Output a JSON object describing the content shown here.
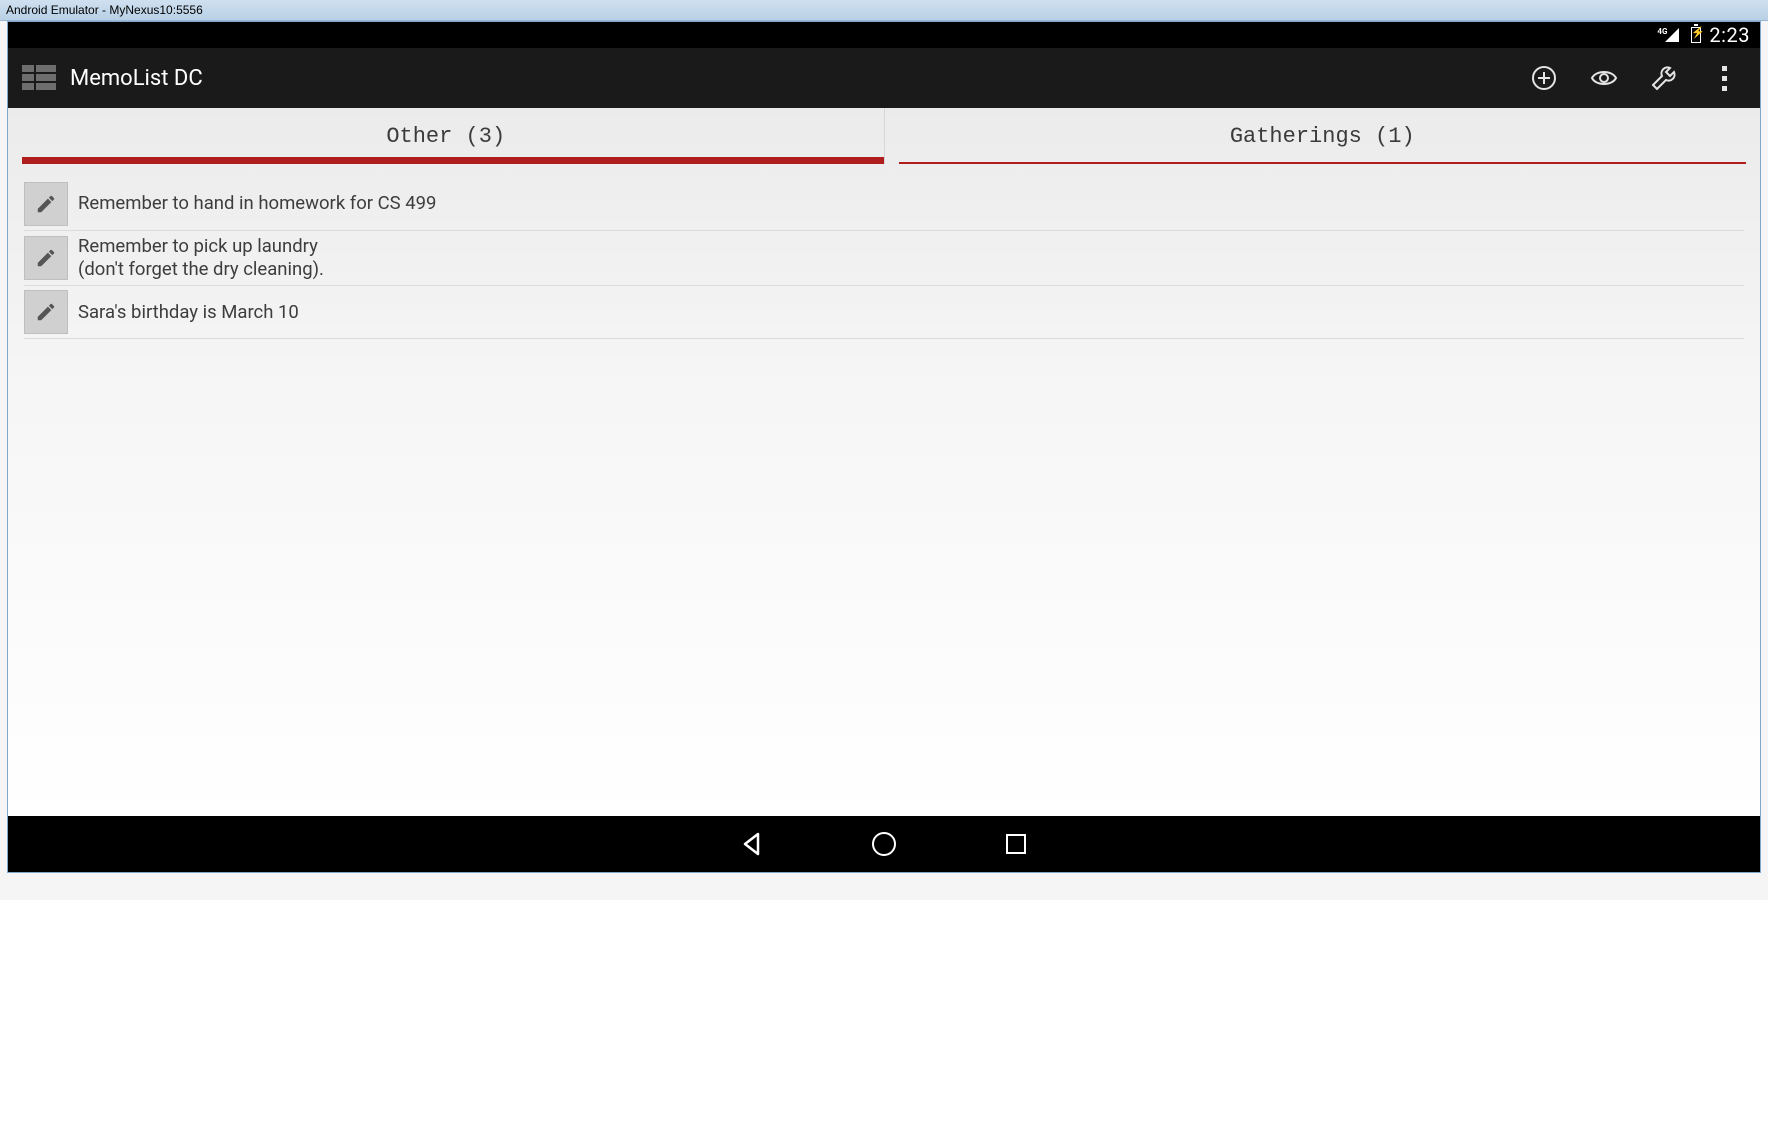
{
  "host": {
    "title": "Android Emulator - MyNexus10:5556"
  },
  "status_bar": {
    "network_label": "4G",
    "clock": "2:23"
  },
  "action_bar": {
    "title": "MemoList DC",
    "actions": {
      "add": "Add memo",
      "view": "View",
      "tools": "Tools",
      "overflow": "More options"
    }
  },
  "tabs": [
    {
      "label": "Other (3)",
      "active": true
    },
    {
      "label": "Gatherings (1)",
      "active": false
    }
  ],
  "memos": [
    {
      "text": "Remember to hand in homework for CS 499"
    },
    {
      "text": "Remember to pick up laundry\n(don't forget the dry cleaning)."
    },
    {
      "text": "Sara's birthday is March 10"
    }
  ],
  "colors": {
    "tab_indicator": "#b01d1d",
    "action_bar_bg": "#1a1a1a"
  }
}
